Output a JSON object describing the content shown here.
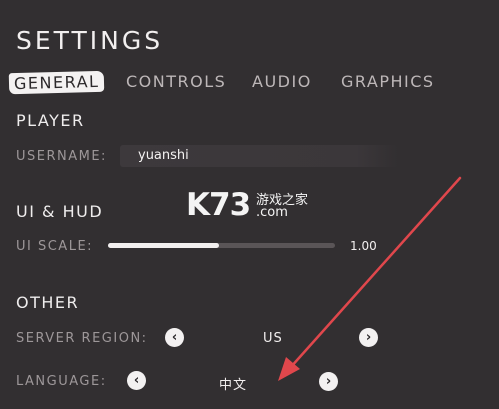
{
  "title": "SETTINGS",
  "tabs": [
    {
      "label": "GENERAL",
      "active": true
    },
    {
      "label": "CONTROLS",
      "active": false
    },
    {
      "label": "AUDIO",
      "active": false
    },
    {
      "label": "GRAPHICS",
      "active": false
    }
  ],
  "player": {
    "heading": "PLAYER",
    "username_label": "USERNAME:",
    "username_value": "yuanshi"
  },
  "ui_hud": {
    "heading": "UI & HUD",
    "ui_scale_label": "UI SCALE:",
    "ui_scale_value": "1.00",
    "ui_scale_fill_fraction": 0.49
  },
  "other": {
    "heading": "OTHER",
    "server_region_label": "SERVER REGION:",
    "server_region_value": "US",
    "language_label": "LANGUAGE:",
    "language_value": "中文"
  },
  "watermark": {
    "logo": "K73",
    "site_cn": "游戏之家",
    "site_com": ".com"
  },
  "icons": {
    "prev": "‹",
    "next": "›"
  },
  "colors": {
    "background": "#322f31",
    "annotation_arrow": "#e0474c",
    "text_primary": "#efeded",
    "text_muted": "#9d9799"
  }
}
